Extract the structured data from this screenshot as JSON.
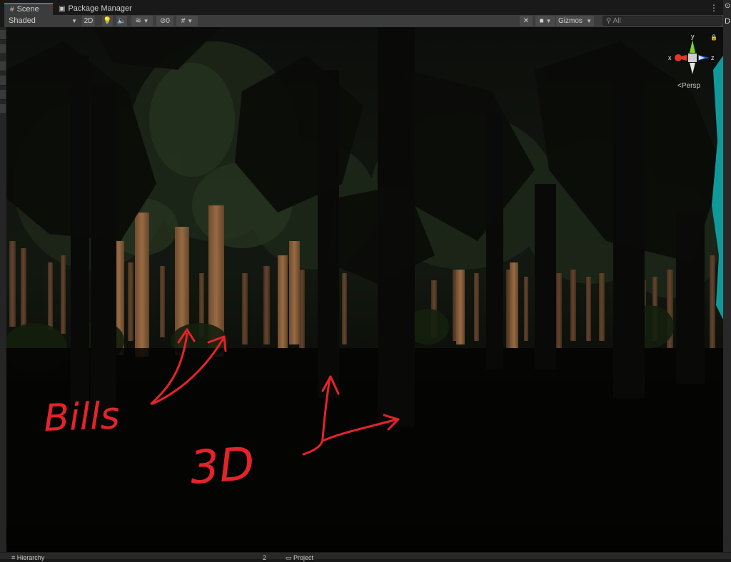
{
  "tabs": {
    "scene": "Scene",
    "package_manager": "Package Manager"
  },
  "icons": {
    "scene": "grid-icon",
    "package": "package-icon",
    "more": "kebab-icon"
  },
  "toolbar": {
    "shading_mode": "Shaded",
    "mode_2d": "2D",
    "fx_count": "0",
    "gizmos": "Gizmos",
    "search_placeholder": "All"
  },
  "gizmo": {
    "y": "y",
    "x": "x",
    "z": "z",
    "projection": "Persp"
  },
  "annotations": {
    "billboards": "Bills",
    "three_d": "3D"
  },
  "right_panel_initial": "D",
  "bottom": {
    "hierarchy": "Hierarchy",
    "project": "Project",
    "count": "2"
  },
  "colors": {
    "annotation": "#e4232a",
    "tab_accent": "#3a79bb",
    "cyan_object": "#12a7a9"
  }
}
